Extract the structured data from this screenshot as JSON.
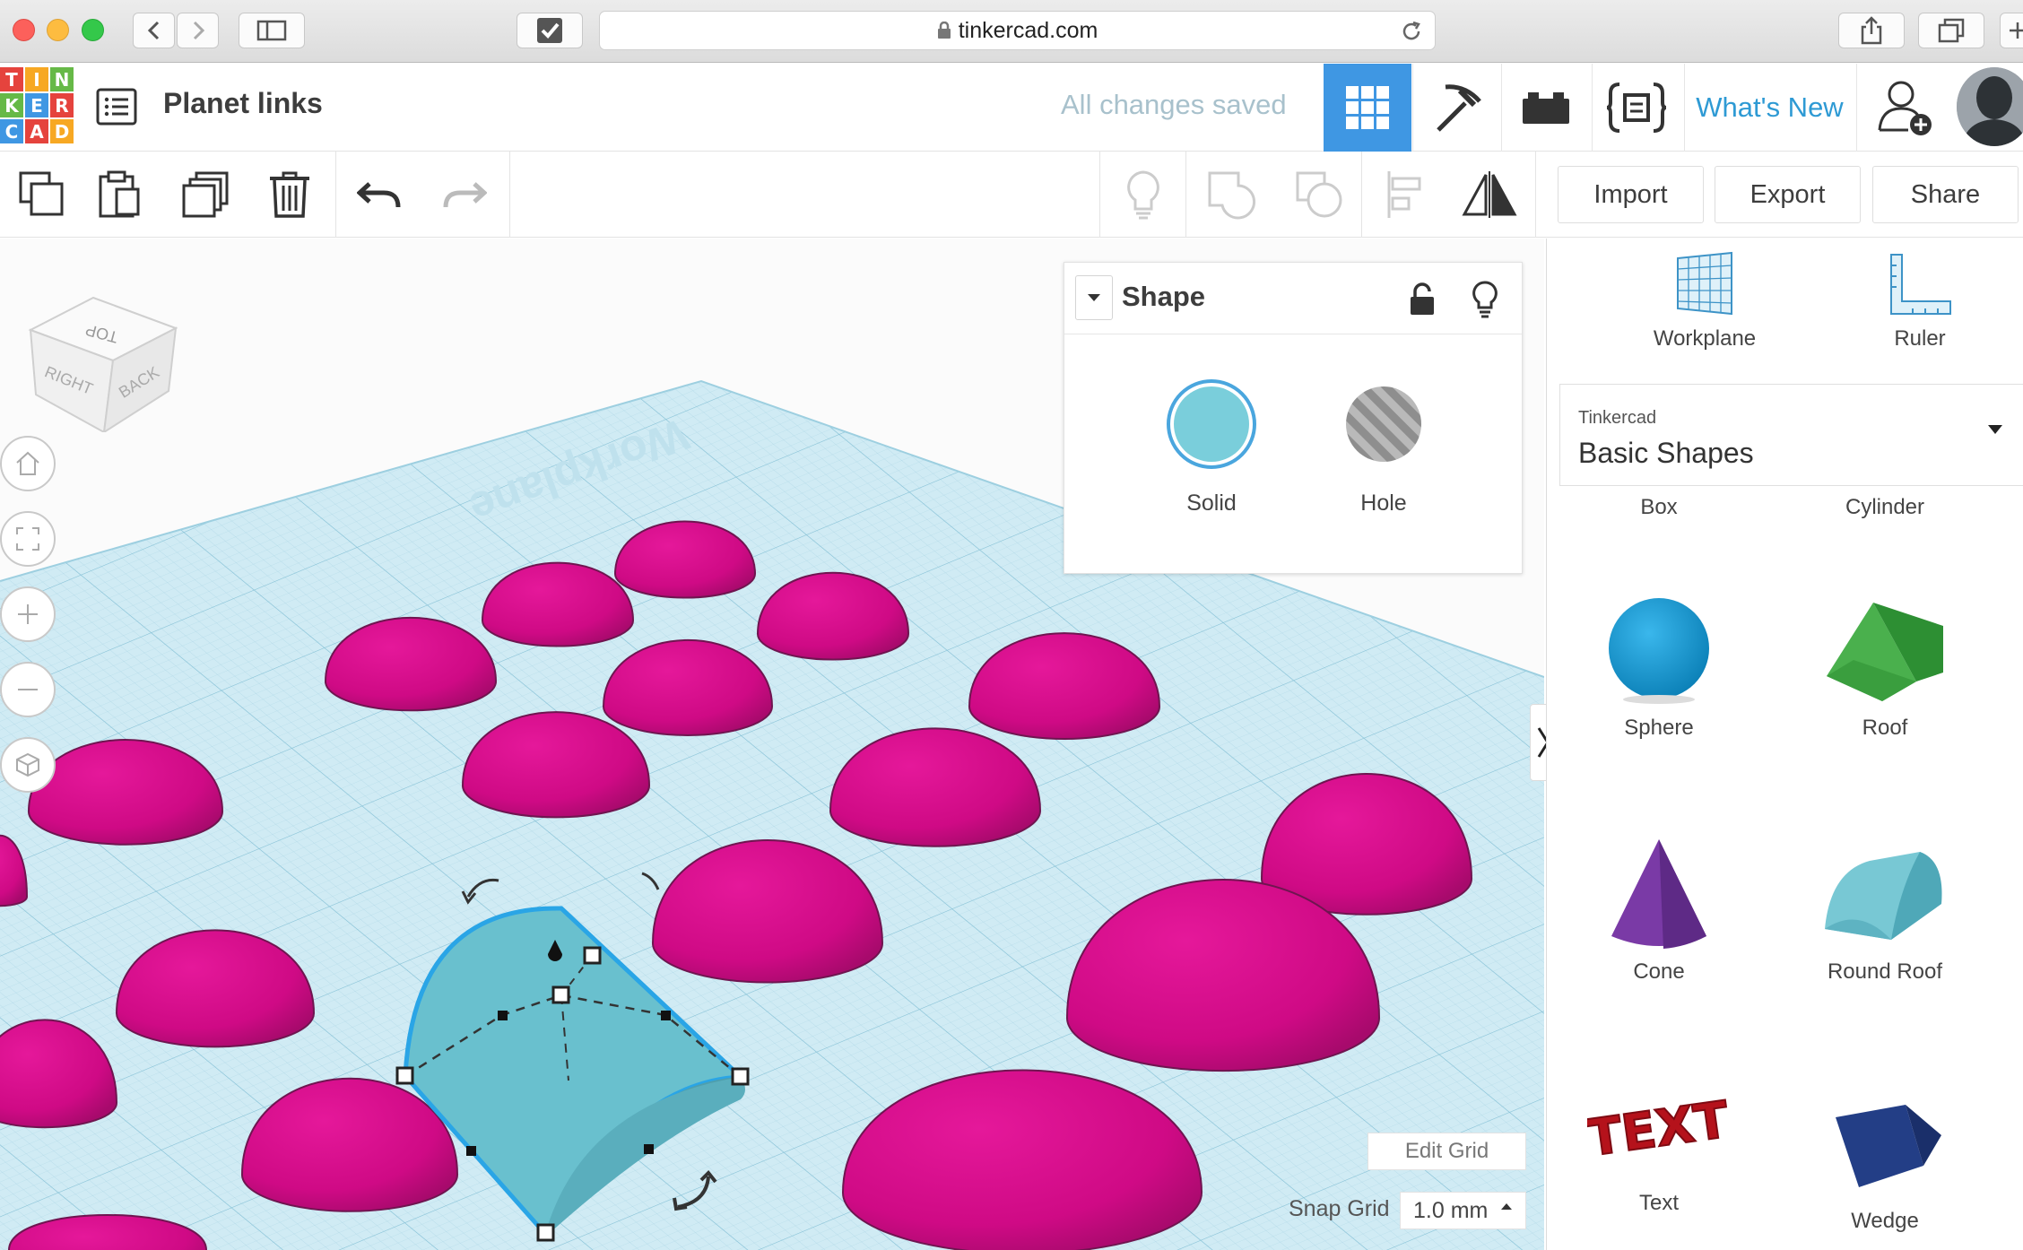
{
  "browser": {
    "url": "tinkercad.com"
  },
  "header": {
    "logo_letters": [
      "T",
      "I",
      "N",
      "K",
      "E",
      "R",
      "C",
      "A",
      "D"
    ],
    "logo_colors": [
      "#e5433d",
      "#f7a823",
      "#66b947",
      "#66b947",
      "#3f97e3",
      "#e5433d",
      "#3f97e3",
      "#e5433d",
      "#f7a823"
    ],
    "project_title": "Planet links",
    "save_status": "All changes saved",
    "whats_new": "What's New"
  },
  "toolbar": {
    "import": "Import",
    "export": "Export",
    "share": "Share"
  },
  "viewcube": {
    "top": "TOP",
    "right": "RIGHT",
    "back": "BACK"
  },
  "workplane_label": "Workplane",
  "inspector": {
    "title": "Shape",
    "solid_label": "Solid",
    "hole_label": "Hole",
    "solid_color": "#7acedb",
    "hole_color": "#9a9a9a"
  },
  "grid": {
    "edit_grid": "Edit Grid",
    "snap_label": "Snap Grid",
    "snap_value": "1.0 mm"
  },
  "right_panel": {
    "workplane_tool": "Workplane",
    "ruler_tool": "Ruler",
    "library_vendor": "Tinkercad",
    "library_name": "Basic Shapes",
    "shapes": [
      "Box",
      "Cylinder",
      "Sphere",
      "Roof",
      "Cone",
      "Round Roof",
      "Text",
      "Wedge"
    ]
  },
  "colors": {
    "accent": "#3f97e3",
    "dome": "#d30a88",
    "grid_bg": "#cfeaf3",
    "selected_shape": "#6cc2d0"
  }
}
